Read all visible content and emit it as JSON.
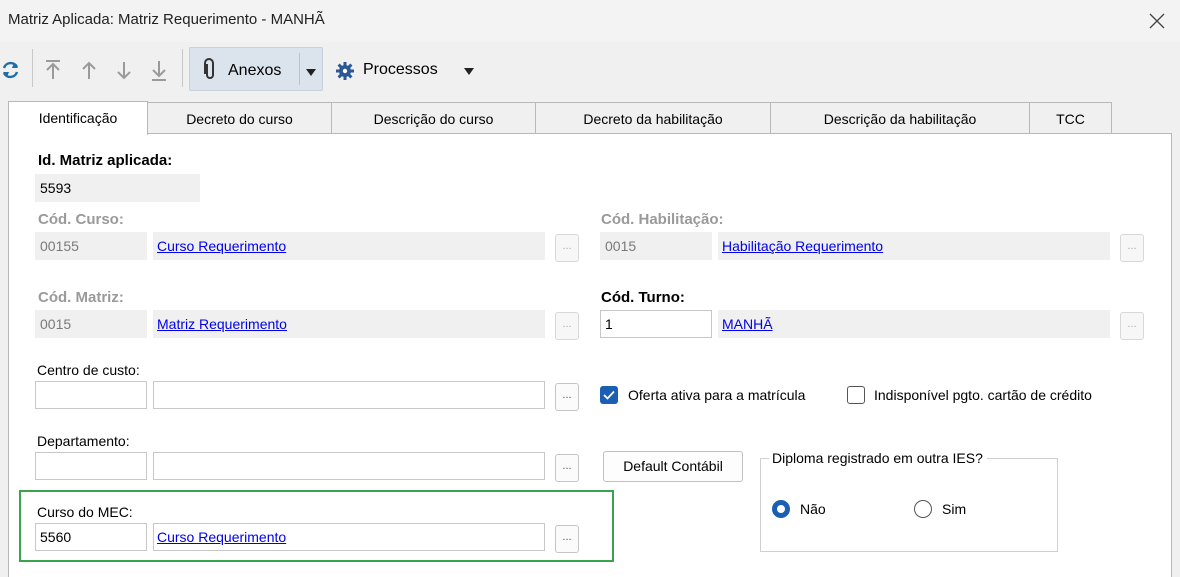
{
  "window": {
    "title": "Matriz Aplicada: Matriz Requerimento - MANHÃ"
  },
  "toolbar": {
    "anexos_label": "Anexos",
    "processos_label": "Processos"
  },
  "tabs": [
    {
      "label": "Identificação",
      "active": true
    },
    {
      "label": "Decreto do curso"
    },
    {
      "label": "Descrição do curso"
    },
    {
      "label": "Decreto da habilitação"
    },
    {
      "label": "Descrição da habilitação"
    },
    {
      "label": "TCC"
    }
  ],
  "form": {
    "id_matriz_label": "Id. Matriz aplicada:",
    "id_matriz_value": "5593",
    "cod_curso_label": "Cód. Curso:",
    "cod_curso_value": "00155",
    "curso_name": "Curso Requerimento",
    "cod_habilitacao_label": "Cód. Habilitação:",
    "cod_habilitacao_value": "0015",
    "habilitacao_name": "Habilitação Requerimento",
    "cod_matriz_label": "Cód. Matriz:",
    "cod_matriz_value": "0015",
    "matriz_name": "Matriz Requerimento",
    "cod_turno_label": "Cód. Turno:",
    "cod_turno_value": "1",
    "turno_name": "MANHÃ",
    "centro_custo_label": "Centro de custo:",
    "centro_custo_code": "",
    "centro_custo_name": "",
    "oferta_ativa_label": "Oferta ativa para a matrícula",
    "oferta_ativa_checked": true,
    "indisponivel_label": "Indisponível pgto. cartão de crédito",
    "indisponivel_checked": false,
    "departamento_label": "Departamento:",
    "departamento_code": "",
    "departamento_name": "",
    "default_contabil_label": "Default Contábil",
    "diploma_group_label": "Diploma registrado em outra IES?",
    "diploma_options": [
      {
        "label": "Não",
        "selected": true
      },
      {
        "label": "Sim",
        "selected": false
      }
    ],
    "curso_mec_label": "Curso do MEC:",
    "curso_mec_value": "5560",
    "curso_mec_name": "Curso Requerimento",
    "dots_label": "..."
  },
  "colors": {
    "accent": "#1a5fb4",
    "highlight_frame": "#3aa34d",
    "link": "#0000ee"
  }
}
